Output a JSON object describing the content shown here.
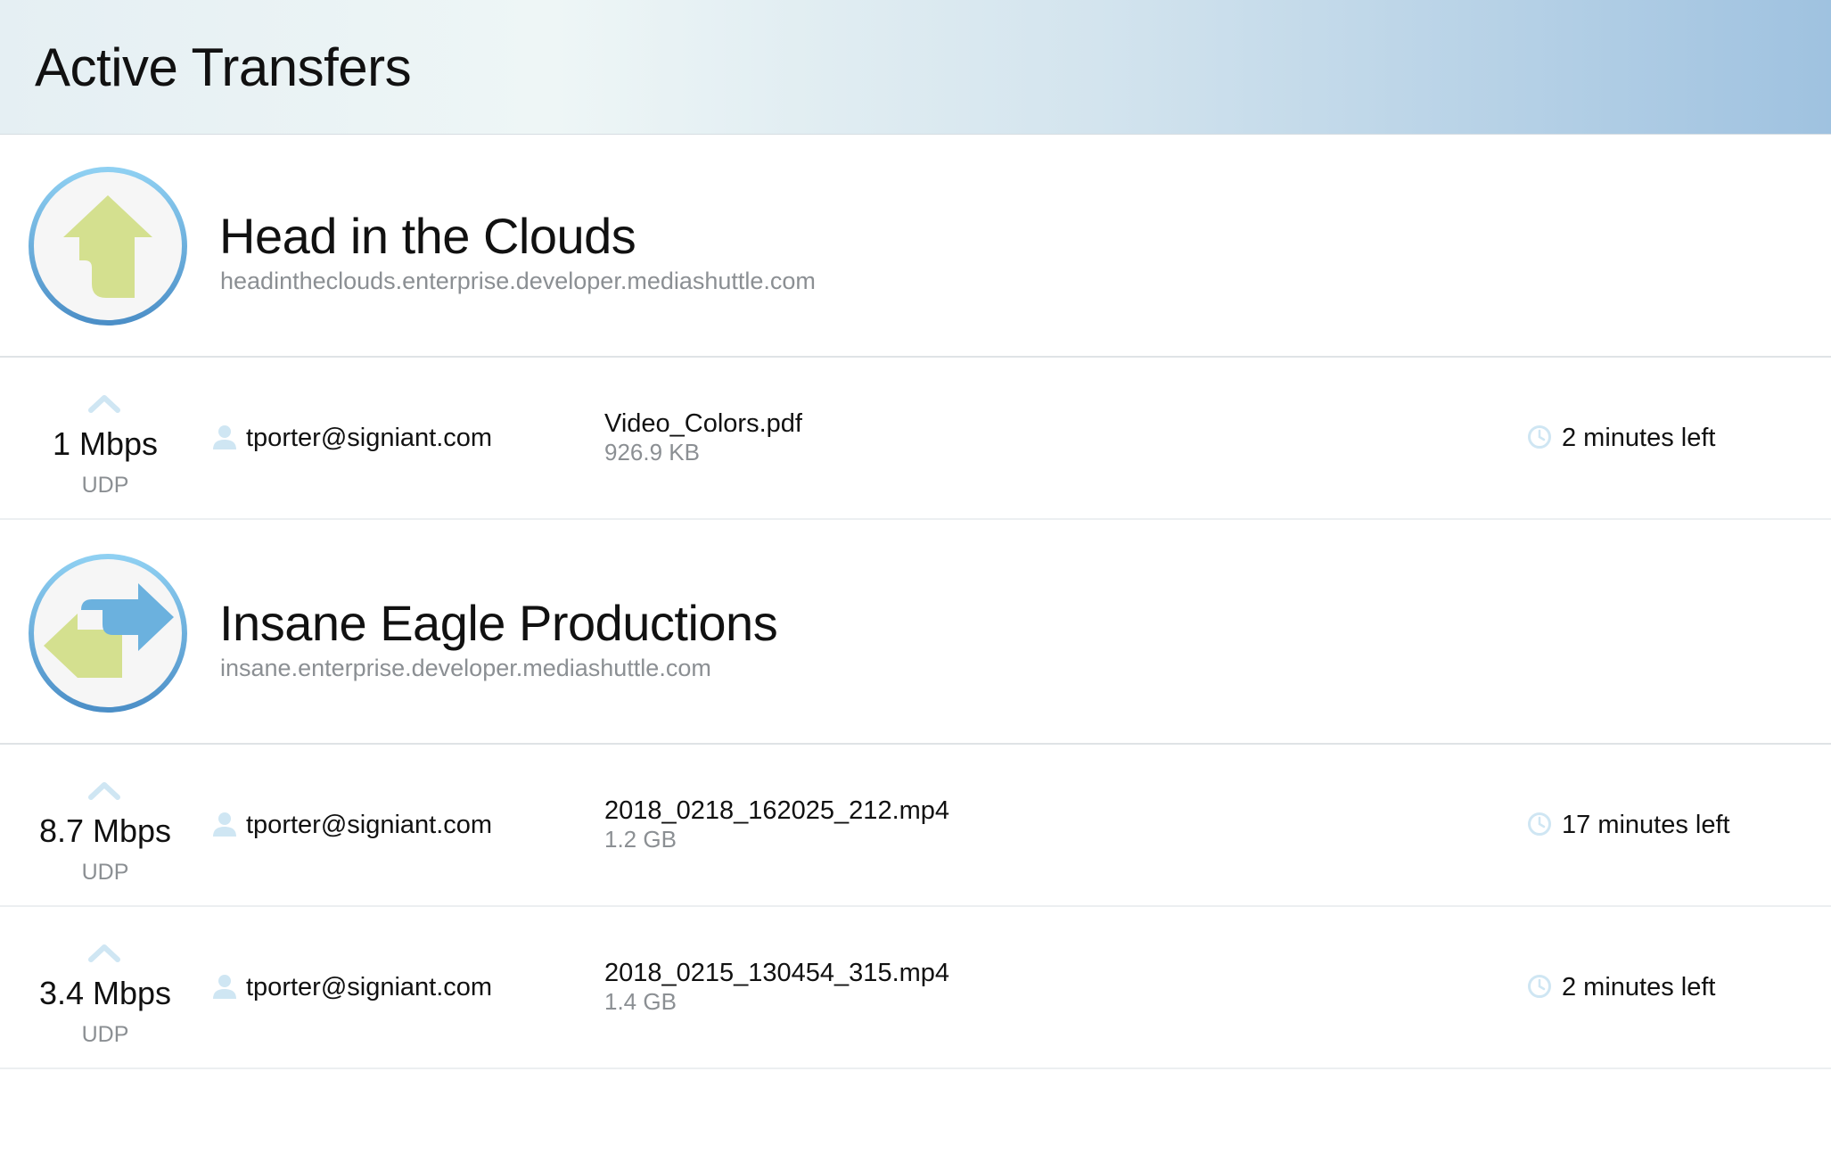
{
  "header": {
    "title": "Active Transfers"
  },
  "colors": {
    "accent_blue": "#5aa5d8",
    "upload_green": "#d4e08f",
    "download_blue": "#6bb1de",
    "secondary_text": "#8b8f93"
  },
  "portals": [
    {
      "name": "Head in the Clouds",
      "url": "headintheclouds.enterprise.developer.mediashuttle.com",
      "icon": "upload-portal-icon",
      "transfers": [
        {
          "direction_icon": "chevron-up-icon",
          "speed": "1 Mbps",
          "protocol": "UDP",
          "user": "tporter@signiant.com",
          "file_name": "Video_Colors.pdf",
          "file_size": "926.9 KB",
          "time_left": "2 minutes left"
        }
      ]
    },
    {
      "name": "Insane Eagle Productions",
      "url": "insane.enterprise.developer.mediashuttle.com",
      "icon": "share-portal-icon",
      "transfers": [
        {
          "direction_icon": "chevron-up-icon",
          "speed": "8.7 Mbps",
          "protocol": "UDP",
          "user": "tporter@signiant.com",
          "file_name": "2018_0218_162025_212.mp4",
          "file_size": "1.2 GB",
          "time_left": "17 minutes left"
        },
        {
          "direction_icon": "chevron-up-icon",
          "speed": "3.4 Mbps",
          "protocol": "UDP",
          "user": "tporter@signiant.com",
          "file_name": "2018_0215_130454_315.mp4",
          "file_size": "1.4 GB",
          "time_left": "2 minutes left"
        }
      ]
    }
  ]
}
